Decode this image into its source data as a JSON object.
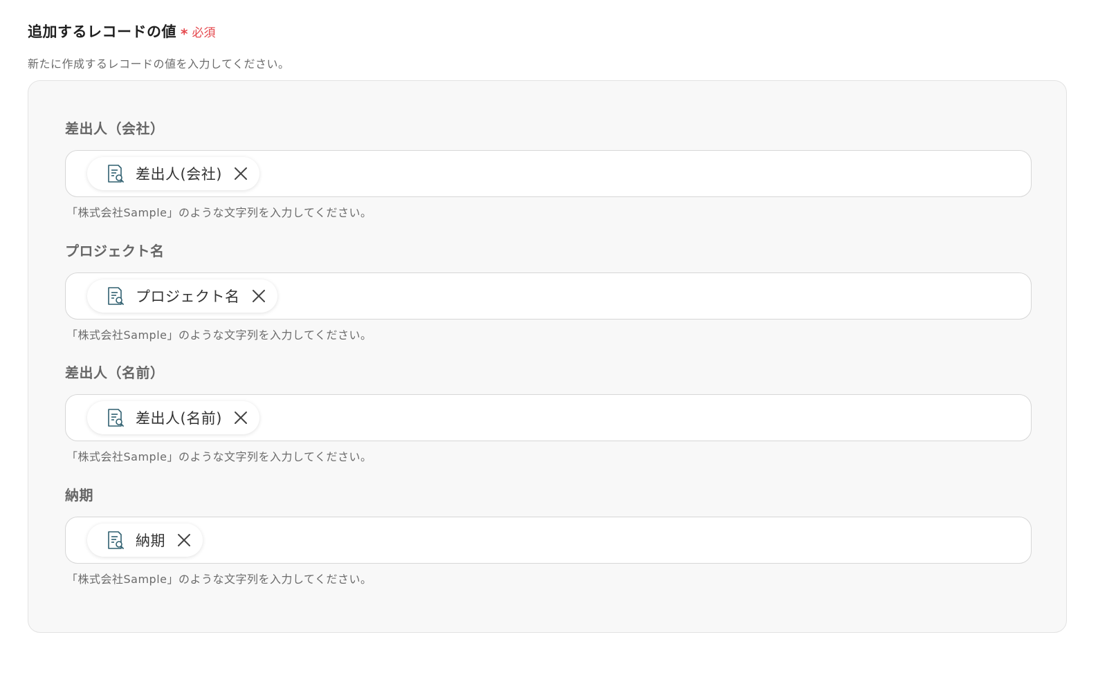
{
  "section": {
    "title": "追加するレコードの値",
    "required_star": "*",
    "required_text": "必須",
    "description": "新たに作成するレコードの値を入力してください。"
  },
  "fields": [
    {
      "label": "差出人（会社）",
      "chip_label": "差出人(会社)",
      "chip_icon": "document-search-icon",
      "hint": "「株式会社Sample」のような文字列を入力してください。"
    },
    {
      "label": "プロジェクト名",
      "chip_label": "プロジェクト名",
      "chip_icon": "document-search-icon",
      "hint": "「株式会社Sample」のような文字列を入力してください。"
    },
    {
      "label": "差出人（名前）",
      "chip_label": "差出人(名前)",
      "chip_icon": "document-search-icon",
      "hint": "「株式会社Sample」のような文字列を入力してください。"
    },
    {
      "label": "納期",
      "chip_label": "納期",
      "chip_icon": "document-search-icon",
      "hint": "「株式会社Sample」のような文字列を入力してください。"
    }
  ],
  "colors": {
    "required": "#e5484d",
    "icon": "#2f5f6f",
    "panel_bg": "#f8f8f8"
  }
}
